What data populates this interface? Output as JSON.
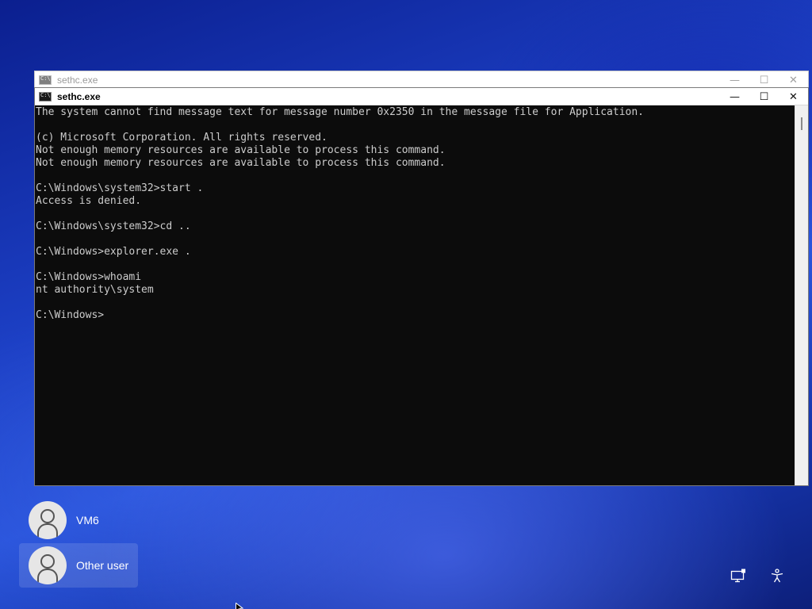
{
  "background_window": {
    "title": "sethc.exe",
    "minimize": "—",
    "maximize": "☐",
    "close": "✕"
  },
  "console_window": {
    "title": "sethc.exe",
    "minimize": "—",
    "maximize": "☐",
    "close": "✕",
    "lines": [
      "The system cannot find message text for message number 0x2350 in the message file for Application.",
      "",
      "(c) Microsoft Corporation. All rights reserved.",
      "Not enough memory resources are available to process this command.",
      "Not enough memory resources are available to process this command.",
      "",
      "C:\\Windows\\system32>start .",
      "Access is denied.",
      "",
      "C:\\Windows\\system32>cd ..",
      "",
      "C:\\Windows>explorer.exe .",
      "",
      "C:\\Windows>whoami",
      "nt authority\\system",
      "",
      "C:\\Windows>"
    ]
  },
  "users": [
    {
      "name": "VM6",
      "selected": false
    },
    {
      "name": "Other user",
      "selected": true
    }
  ],
  "corner_icons": [
    "network-icon",
    "accessibility-icon"
  ],
  "colors": {
    "console_bg": "#0c0c0c",
    "console_text": "#cccccc",
    "desktop_blue": "#1c3fc4"
  }
}
